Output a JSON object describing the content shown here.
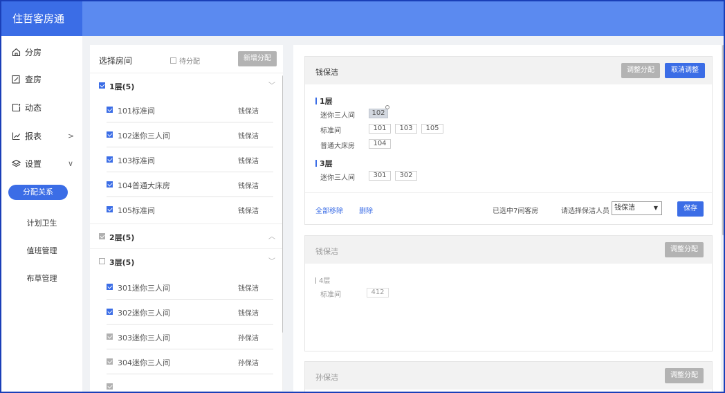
{
  "app": {
    "title": "住哲客房通"
  },
  "sidebar": {
    "items": [
      {
        "label": "分房",
        "icon": "home-icon"
      },
      {
        "label": "查房",
        "icon": "edit-icon"
      },
      {
        "label": "动态",
        "icon": "activity-icon"
      },
      {
        "label": "报表",
        "icon": "chart-icon",
        "arrow": ">"
      },
      {
        "label": "设置",
        "icon": "layers-icon",
        "arrow": "∨"
      }
    ],
    "sub_items": [
      {
        "label": "分配关系",
        "active": true
      },
      {
        "label": "计划卫生",
        "active": false
      },
      {
        "label": "值班管理",
        "active": false
      },
      {
        "label": "布草管理",
        "active": false
      }
    ]
  },
  "room_select": {
    "title": "选择房间",
    "pending_label": "待分配",
    "add_button": "新增分配",
    "floors": [
      {
        "label": "1层(5)",
        "state": "checked",
        "chevron": "﹀",
        "rooms": [
          {
            "label": "101标准间",
            "cleaner": "钱保洁",
            "state": "checked"
          },
          {
            "label": "102迷你三人间",
            "cleaner": "钱保洁",
            "state": "checked"
          },
          {
            "label": "103标准间",
            "cleaner": "钱保洁",
            "state": "checked"
          },
          {
            "label": "104普通大床房",
            "cleaner": "钱保洁",
            "state": "checked"
          },
          {
            "label": "105标准间",
            "cleaner": "钱保洁",
            "state": "checked"
          }
        ]
      },
      {
        "label": "2层(5)",
        "state": "disabled",
        "chevron": "︿",
        "rooms": []
      },
      {
        "label": "3层(5)",
        "state": "unchecked",
        "chevron": "﹀",
        "rooms": [
          {
            "label": "301迷你三人间",
            "cleaner": "钱保洁",
            "state": "checked"
          },
          {
            "label": "302迷你三人间",
            "cleaner": "钱保洁",
            "state": "checked"
          },
          {
            "label": "303迷你三人间",
            "cleaner": "孙保洁",
            "state": "disabled"
          },
          {
            "label": "304迷你三人间",
            "cleaner": "孙保洁",
            "state": "disabled"
          }
        ]
      }
    ]
  },
  "assign_card_1": {
    "name": "钱保洁",
    "adjust_button": "调整分配",
    "cancel_button": "取消调整",
    "floors": [
      {
        "title": "1层",
        "groups": [
          {
            "type": "迷你三人间",
            "rooms": [
              "102"
            ]
          },
          {
            "type": "标准间",
            "rooms": [
              "101",
              "103",
              "105"
            ]
          },
          {
            "type": "普通大床房",
            "rooms": [
              "104"
            ]
          }
        ]
      },
      {
        "title": "3层",
        "groups": [
          {
            "type": "迷你三人间",
            "rooms": [
              "301",
              "302"
            ]
          }
        ]
      }
    ],
    "remove_all": "全部移除",
    "delete": "删除",
    "selected_text": "已选中7间客房",
    "choose_label": "请选择保洁人员",
    "select_value": "钱保洁",
    "save_button": "保存"
  },
  "assign_card_2": {
    "name": "钱保洁",
    "adjust_button": "调整分配",
    "floor_title": "4层",
    "type": "标准间",
    "room": "412"
  },
  "assign_card_3": {
    "name": "孙保洁",
    "adjust_button": "调整分配"
  },
  "colors": {
    "primary": "#3b6de6",
    "topbar": "#5b8af0",
    "brand": "#3b6de6",
    "frame": "#1a3fb8"
  }
}
